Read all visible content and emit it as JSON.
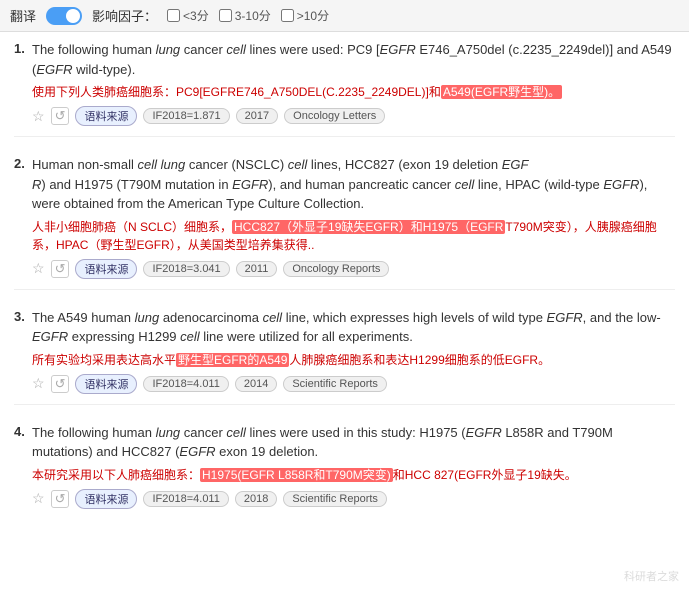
{
  "topbar": {
    "toggle_label": "翻译",
    "filter_label": "影响因子：",
    "options": [
      {
        "label": "<3分",
        "checked": false
      },
      {
        "label": "3-10分",
        "checked": false
      },
      {
        "label": ">10分",
        "checked": false
      }
    ]
  },
  "results": [
    {
      "number": "1.",
      "text_segments": [
        {
          "text": "The following human ",
          "type": "normal"
        },
        {
          "text": "lung",
          "type": "cell-italic"
        },
        {
          "text": " cancer ",
          "type": "normal"
        },
        {
          "text": "cell",
          "type": "cell-italic"
        },
        {
          "text": " lines were used: PC9 [",
          "type": "normal"
        },
        {
          "text": "EGFR",
          "type": "egfr-italic"
        },
        {
          "text": " E746_A750del (c.2235_2249del)] and A549 (",
          "type": "normal"
        },
        {
          "text": "EGFR",
          "type": "egfr-italic"
        },
        {
          "text": " wild-type).",
          "type": "normal"
        }
      ],
      "chinese": [
        {
          "text": "使用下列人类肺癌细胞系：PC9[EGFRE746_A750DEL(C.2235_2249DEL)]和",
          "type": "normal"
        },
        {
          "text": "A549(EGFR野生型)。",
          "type": "highlight-red"
        }
      ],
      "meta": {
        "if": "IF2018=1.871",
        "year": "2017",
        "source": "Oncology Letters"
      }
    },
    {
      "number": "2.",
      "text_segments": [
        {
          "text": "Human non-small ",
          "type": "normal"
        },
        {
          "text": "cell",
          "type": "cell-italic"
        },
        {
          "text": " ",
          "type": "normal"
        },
        {
          "text": "lung",
          "type": "cell-italic"
        },
        {
          "text": " cancer (NSCLC) ",
          "type": "normal"
        },
        {
          "text": "cell",
          "type": "cell-italic"
        },
        {
          "text": " lines, ",
          "type": "normal"
        },
        {
          "text": "HCC827 (外显子19缺失EGFR)",
          "type": "highlight-yellow-inline"
        },
        {
          "text": " (exon 19 deletion ",
          "type": "normal"
        },
        {
          "text": "EGF\nR",
          "type": "egfr-italic"
        },
        {
          "text": ") and H1975 (T790M mutation in ",
          "type": "normal"
        },
        {
          "text": "EGFR",
          "type": "egfr-italic"
        },
        {
          "text": "), and human pancreatic cancer ",
          "type": "normal"
        },
        {
          "text": "cell",
          "type": "cell-italic"
        },
        {
          "text": " line, HPAC (wild-type ",
          "type": "normal"
        },
        {
          "text": "EGFR",
          "type": "egfr-italic"
        },
        {
          "text": "), were obtained from the American Type Culture Collection.",
          "type": "normal"
        }
      ],
      "chinese": [
        {
          "text": "人非小细胞肺癌（N SCLC）细胞系，",
          "type": "normal"
        },
        {
          "text": "HCC827（外显子19缺失EGFR）和H1975（EGFR",
          "type": "highlight-red"
        },
        {
          "text": "T790M突变），人胰腺癌细胞系，HPAC（野生型EGFR），从美国类型培养集获得..",
          "type": "normal"
        }
      ],
      "meta": {
        "if": "IF2018=3.041",
        "year": "2011",
        "source": "Oncology Reports"
      }
    },
    {
      "number": "3.",
      "text_segments": [
        {
          "text": "The A549 human ",
          "type": "normal"
        },
        {
          "text": "lung",
          "type": "cell-italic"
        },
        {
          "text": " adenocarcinoma ",
          "type": "normal"
        },
        {
          "text": "cell",
          "type": "cell-italic"
        },
        {
          "text": " line, which expresses high levels of wild type ",
          "type": "normal"
        },
        {
          "text": "EGFR",
          "type": "egfr-italic"
        },
        {
          "text": ", and the low-",
          "type": "normal"
        },
        {
          "text": "EGFR",
          "type": "egfr-italic"
        },
        {
          "text": " expressing H1299 ",
          "type": "normal"
        },
        {
          "text": "cell",
          "type": "cell-italic"
        },
        {
          "text": " line were utilized for all experiments.",
          "type": "normal"
        }
      ],
      "chinese": [
        {
          "text": "所有实验均采用表达高水平",
          "type": "normal"
        },
        {
          "text": "野生型EGFR的A549",
          "type": "highlight-red"
        },
        {
          "text": "人肺腺癌细胞系和表达H1299细胞系的低EGFR。",
          "type": "normal"
        }
      ],
      "meta": {
        "if": "IF2018=4.011",
        "year": "2014",
        "source": "Scientific Reports"
      }
    },
    {
      "number": "4.",
      "text_segments": [
        {
          "text": "The following human ",
          "type": "normal"
        },
        {
          "text": "lung",
          "type": "cell-italic"
        },
        {
          "text": " cancer ",
          "type": "normal"
        },
        {
          "text": "cell",
          "type": "cell-italic"
        },
        {
          "text": " lines were used in this study: H1975 (",
          "type": "normal"
        },
        {
          "text": "EGFR",
          "type": "egfr-italic"
        },
        {
          "text": " L858R and T790M mutations) and HCC827 (",
          "type": "normal"
        },
        {
          "text": "EGFR",
          "type": "egfr-italic"
        },
        {
          "text": " exon 19 deletion.",
          "type": "normal"
        }
      ],
      "chinese": [
        {
          "text": "本研究采用以下人肺癌细胞系：",
          "type": "normal"
        },
        {
          "text": "H1975(EGFR L858R和T790M突变)",
          "type": "highlight-red"
        },
        {
          "text": "和HCC 827(EGFR外显子19缺失。",
          "type": "normal"
        }
      ],
      "meta": {
        "if": "IF2018=4.011",
        "year": "2018",
        "source": "Scientific Reports"
      }
    }
  ],
  "watermark": "科研者之家",
  "badges": {
    "source_label": "语料来源"
  }
}
